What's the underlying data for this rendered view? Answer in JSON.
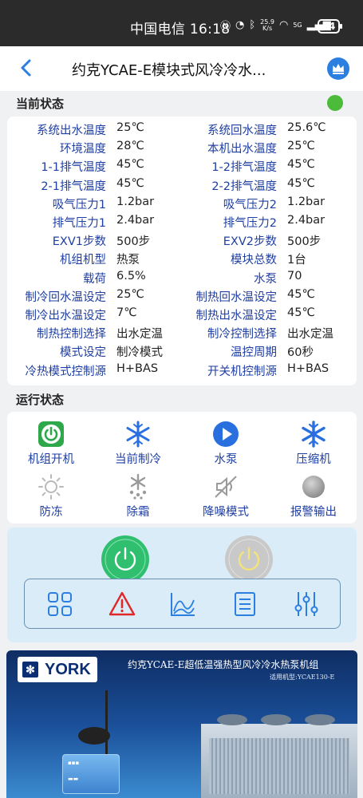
{
  "status_bar": {
    "carrier_time": "中国电信 16:18",
    "net_speed_value": "25.9",
    "net_speed_unit": "K/s",
    "signal": "5G",
    "battery": "64"
  },
  "header": {
    "title": "约克YCAE-E模块式风冷冷水..."
  },
  "current_status": {
    "title": "当前状态",
    "indicator_color": "#4cbb3a",
    "rows": [
      {
        "l_label": "系统出水温度",
        "l_value": "25℃",
        "r_label": "系统回水温度",
        "r_value": "25.6℃"
      },
      {
        "l_label": "环境温度",
        "l_value": "28℃",
        "r_label": "本机出水温度",
        "r_value": "25℃"
      },
      {
        "l_label": "1-1排气温度",
        "l_value": "45℃",
        "r_label": "1-2排气温度",
        "r_value": "45℃"
      },
      {
        "l_label": "2-1排气温度",
        "l_value": "45℃",
        "r_label": "2-2排气温度",
        "r_value": "45℃"
      },
      {
        "l_label": "吸气压力1",
        "l_value": "1.2bar",
        "r_label": "吸气压力2",
        "r_value": "1.2bar"
      },
      {
        "l_label": "排气压力1",
        "l_value": "2.4bar",
        "r_label": "排气压力2",
        "r_value": "2.4bar"
      },
      {
        "l_label": "EXV1步数",
        "l_value": "500步",
        "r_label": "EXV2步数",
        "r_value": "500步"
      },
      {
        "l_label": "机组机型",
        "l_value": "热泵",
        "r_label": "模块总数",
        "r_value": "1台"
      },
      {
        "l_label": "载荷",
        "l_value": "6.5%",
        "r_label": "水泵",
        "r_value": "70"
      },
      {
        "l_label": "制冷回水温设定",
        "l_value": "25℃",
        "r_label": "制热回水温设定",
        "r_value": "45℃"
      },
      {
        "l_label": "制冷出水温设定",
        "l_value": "7℃",
        "r_label": "制热出水温设定",
        "r_value": "45℃"
      },
      {
        "l_label": "制热控制选择",
        "l_value": "出水定温",
        "r_label": "制冷控制选择",
        "r_value": "出水定温"
      },
      {
        "l_label": "模式设定",
        "l_value": "制冷模式",
        "r_label": "温控周期",
        "r_value": "60秒"
      },
      {
        "l_label": "冷热模式控制源",
        "l_value": "H+BAS",
        "r_label": "开关机控制源",
        "r_value": "H+BAS"
      }
    ]
  },
  "run_status": {
    "title": "运行状态",
    "items": [
      {
        "label": "机组开机",
        "icon": "power-on-icon",
        "color": "#2ea84a"
      },
      {
        "label": "当前制冷",
        "icon": "snowflake-icon",
        "color": "#2a6fe0"
      },
      {
        "label": "水泵",
        "icon": "play-icon",
        "color": "#2a6fe0"
      },
      {
        "label": "压缩机",
        "icon": "snowflake-icon",
        "color": "#2a6fe0"
      },
      {
        "label": "防冻",
        "icon": "sun-icon",
        "color": "#b9b9b9"
      },
      {
        "label": "除霜",
        "icon": "defrost-icon",
        "color": "#9a9a9a"
      },
      {
        "label": "降噪模式",
        "icon": "mute-icon",
        "color": "#9a9a9a"
      },
      {
        "label": "报警输出",
        "icon": "alarm-dot-icon",
        "color": "#a8a8a8"
      }
    ]
  },
  "controls": {
    "power_on_color": "#2fbf6f",
    "power_off_color": "#c9c9c9",
    "toolbar_icons": [
      "grid-icon",
      "warning-icon",
      "chart-icon",
      "list-icon",
      "sliders-icon"
    ]
  },
  "banner": {
    "brand": "YORK",
    "title": "约克YCAE-E超低温强热型风冷冷水热泵机组",
    "subtitle": "适用机型:YCAE130-E"
  }
}
